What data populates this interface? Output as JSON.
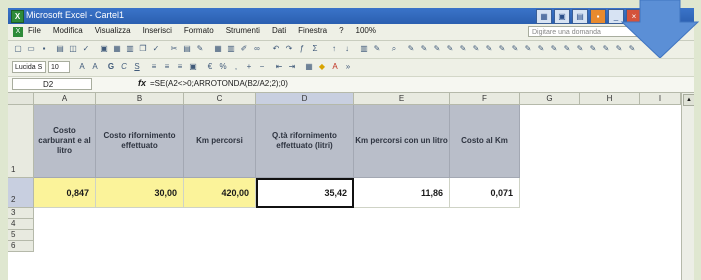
{
  "window": {
    "title": "Microsoft Excel - Cartel1",
    "app_icon": "excel-icon"
  },
  "menu": {
    "items": [
      "File",
      "Modifica",
      "Visualizza",
      "Inserisci",
      "Formato",
      "Strumenti",
      "Dati",
      "Finestra",
      "?"
    ],
    "zoom": "100%",
    "help_placeholder": "Digitare una domanda"
  },
  "formatting": {
    "font": "Lucida S",
    "size": "10"
  },
  "formula_bar": {
    "cell_ref": "D2",
    "fx": "fx",
    "formula": "=SE(A2<>0;ARROTONDA(B2/A2;2);0)"
  },
  "columns": [
    "A",
    "B",
    "C",
    "D",
    "E",
    "F",
    "G",
    "H",
    "I"
  ],
  "rows": [
    "1",
    "2",
    "3",
    "4",
    "5",
    "6"
  ],
  "headers": [
    "Costo carburant e al litro",
    "Costo rifornimento effettuato",
    "Km percorsi",
    "Q.tà rifornimento effettuato (litri)",
    "Km percorsi con un litro",
    "Costo al Km"
  ],
  "values": [
    "0,847",
    "30,00",
    "420,00",
    "35,42",
    "11,86",
    "0,071"
  ],
  "colors": {
    "header_fill": "#b9bec9",
    "input_fill": "#fbf39a",
    "selection": "#111111",
    "arrow": "#5b8fd6"
  }
}
